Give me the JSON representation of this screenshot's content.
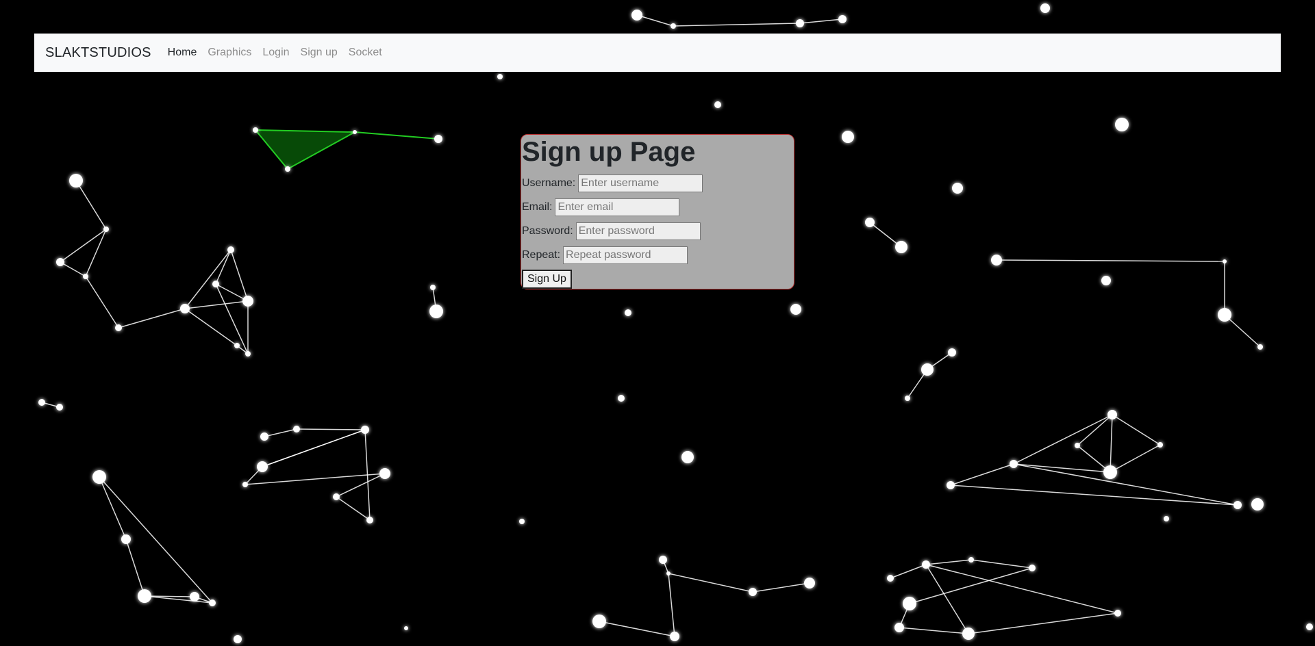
{
  "navbar": {
    "brand": "SLAKTSTUDIOS",
    "links": [
      "Home",
      "Graphics",
      "Login",
      "Sign up",
      "Socket"
    ],
    "active": "Home"
  },
  "signup": {
    "title": "Sign up Page",
    "fields": [
      {
        "label": "Username:",
        "placeholder": "Enter username"
      },
      {
        "label": "Email:",
        "placeholder": "Enter email"
      },
      {
        "label": "Password:",
        "placeholder": "Enter password"
      },
      {
        "label": "Repeat:",
        "placeholder": "Repeat password"
      }
    ],
    "button": "Sign Up"
  },
  "colors": {
    "background": "#000000",
    "navbar": "#f8f9fa",
    "card": "#aaaaaa",
    "card_border": "#bb3333",
    "node": "#ffffff",
    "highlight_edge": "#22cc22"
  }
}
